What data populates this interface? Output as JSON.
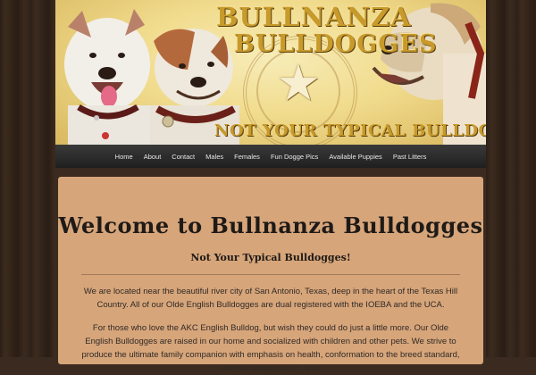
{
  "banner": {
    "brand_line1": "BULLNANZA",
    "brand_line2": "BULLDOGGES",
    "tagline": "NOT YOUR TYPICAL BULLDOGGES"
  },
  "nav": {
    "items": [
      "Home",
      "About",
      "Contact",
      "Males",
      "Females",
      "Fun Dogge Pics",
      "Available Puppies",
      "Past Litters"
    ]
  },
  "content": {
    "heading": "Welcome to Bullnanza Bulldogges",
    "subheading": "Not Your Typical Bulldogges!",
    "paragraph1": "We are located near the beautiful river city of San Antonio, Texas, deep in the heart of the Texas Hill Country. All of our Olde English Bulldogges are dual registered with the IOEBA and the UCA.",
    "paragraph2": "For those who love the AKC English Bulldog, but wish they could do just a little more. Our Olde English Bulldogges are raised in our home and socialized with children and other pets. We strive to produce the ultimate family companion with emphasis on health, conformation to the breed standard, correct temperament, and"
  },
  "colors": {
    "content_bg": "#d7a57a",
    "nav_bg": "#2a2a2a",
    "brand_gold": "#c89a2a"
  }
}
